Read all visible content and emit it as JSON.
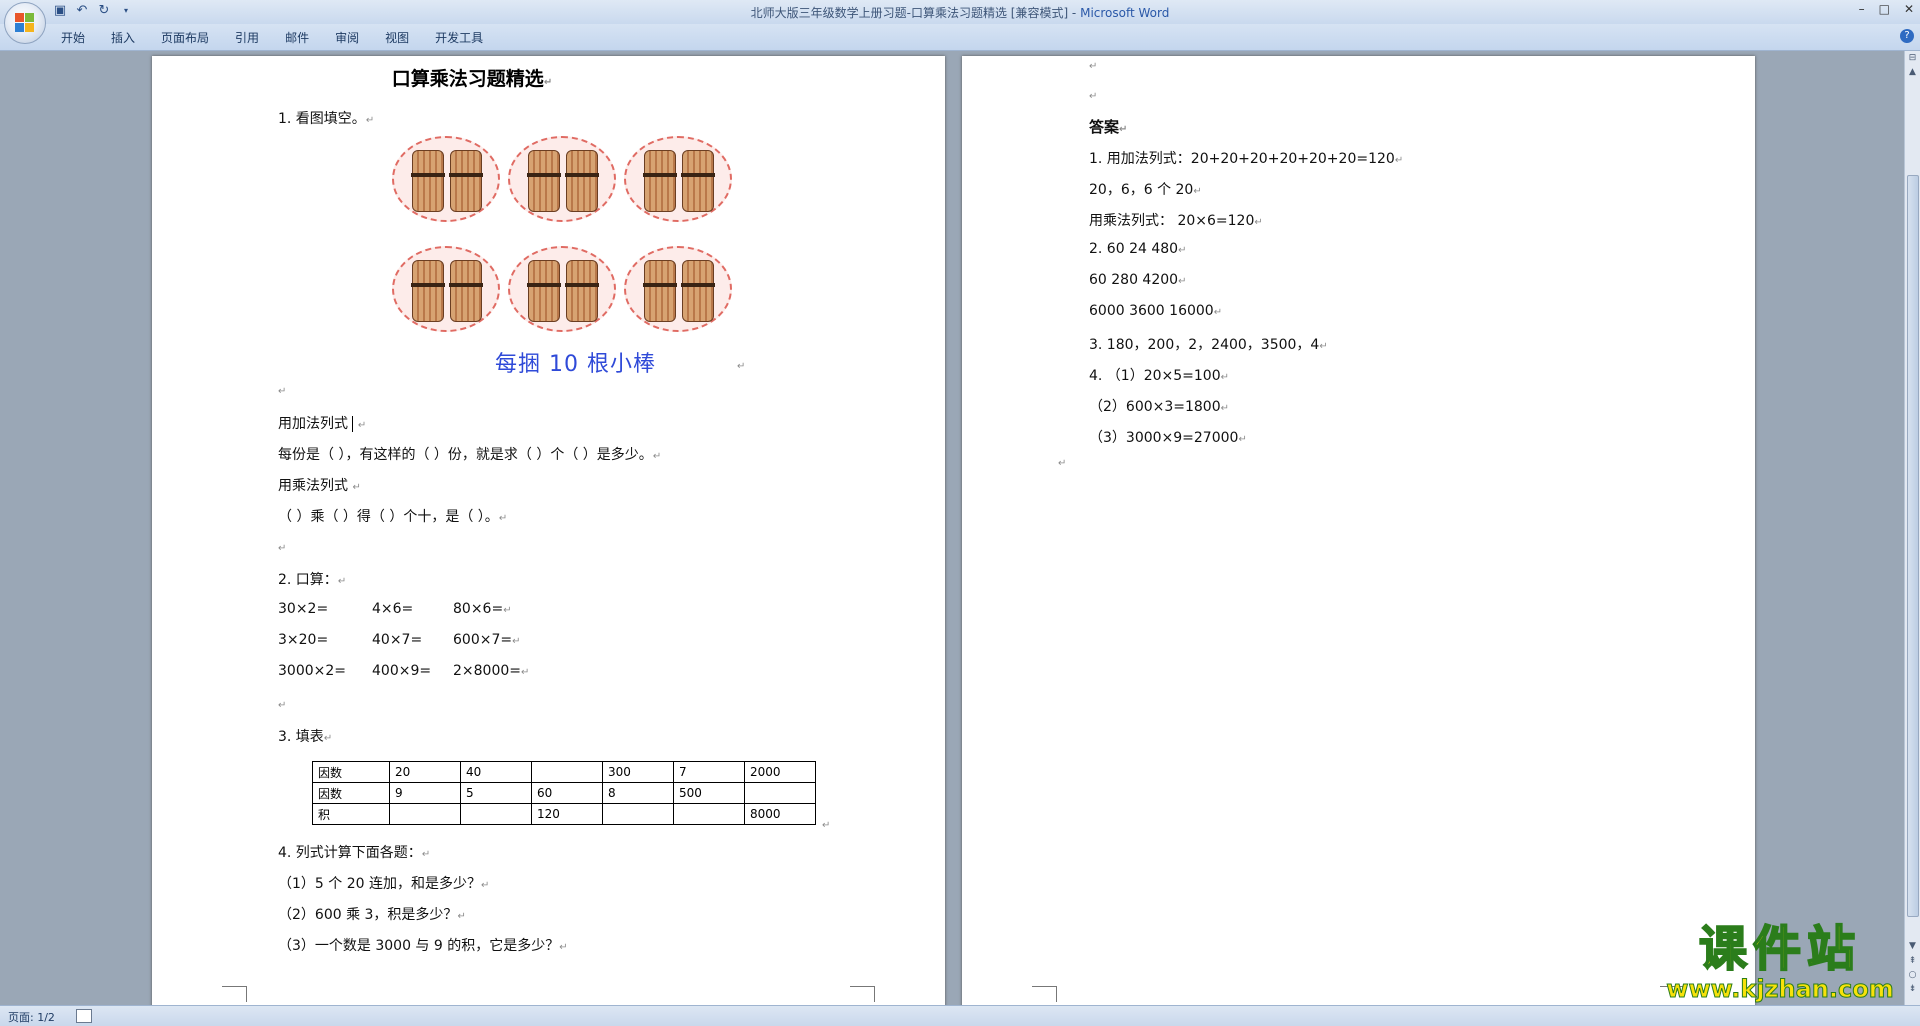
{
  "window": {
    "title": "北师大版三年级数学上册习题-口算乘法习题精选 [兼容模式] - ",
    "app_name": "Microsoft Word",
    "minimize": "–",
    "maximize": "□",
    "close": "✕"
  },
  "ribbon": {
    "tabs": [
      "开始",
      "插入",
      "页面布局",
      "引用",
      "邮件",
      "审阅",
      "视图",
      "开发工具"
    ]
  },
  "page1": {
    "title": "口算乘法习题精选",
    "q1_heading": "1.   看图填空。",
    "picture_caption": "每捆 10 根小棒",
    "add_expr": "用加法列式 ",
    "each_share": "每份是（ ），有这样的（ ）份，就是求（ ）个（ ）是多少。",
    "mul_expr": "用乘法列式 ",
    "mul_desc": "（ ）乘（ ）得（ ）个十，是（ ）。",
    "q2_heading": "2. 口算：",
    "q2_rows": [
      [
        "30×2=",
        "4×6=",
        "80×6="
      ],
      [
        "3×20=",
        "40×7=",
        "600×7="
      ],
      [
        "3000×2=",
        "400×9=",
        "2×8000="
      ]
    ],
    "q3_heading": "3. 填表",
    "table": [
      [
        "因数",
        "20",
        "40",
        "",
        "300",
        "7",
        "2000"
      ],
      [
        "因数",
        "9",
        "5",
        "60",
        "8",
        "500",
        ""
      ],
      [
        "积",
        "",
        "",
        "120",
        "",
        "",
        "8000"
      ]
    ],
    "q4_heading": "4. 列式计算下面各题：",
    "q4_items": [
      "（1）5 个 20 连加，和是多少？",
      "（2）600 乘 3，积是多少？",
      "（3）一个数是 3000 与 9 的积，它是多少？"
    ]
  },
  "page2": {
    "answer_title": "答案",
    "lines": [
      "1. 用加法列式：20+20+20+20+20+20=120",
      "20，6，6 个 20",
      "用乘法列式： 20×6=120",
      "2.   60  24  480",
      "60  280  4200",
      "6000  3600  16000",
      "3.   180，200，2，2400，3500，4",
      "4.  （1）20×5=100",
      "（2）600×3=1800",
      "（3）3000×9=27000"
    ]
  },
  "status": {
    "page": "页面: 1/2"
  },
  "watermark": {
    "title": "课件站",
    "url": "www.kjzhan.com"
  },
  "colors": {
    "caption_blue": "#2f4ad8",
    "title_app_blue": "#2a58a8",
    "watermark_yellow": "#f7e20a",
    "watermark_green": "#2b7d1b"
  }
}
